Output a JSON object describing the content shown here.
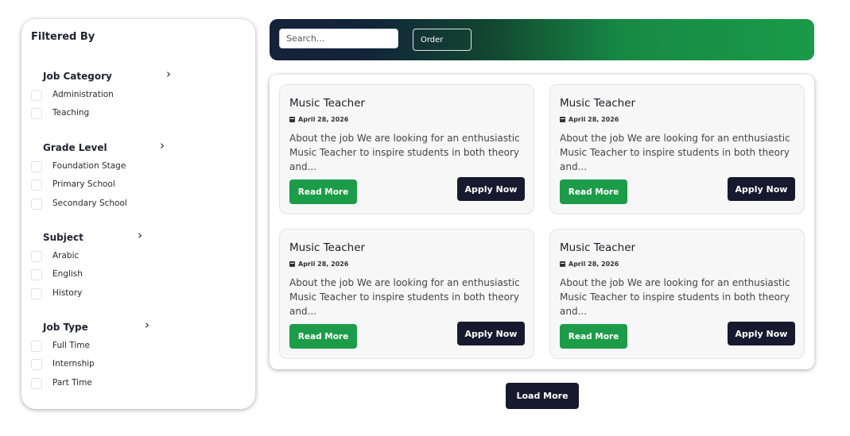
{
  "sidebar": {
    "title": "Filtered By",
    "groups": [
      {
        "heading": "Job Category",
        "options": [
          "Administration",
          "Teaching"
        ]
      },
      {
        "heading": "Grade Level",
        "options": [
          "Foundation Stage",
          "Primary School",
          "Secondary School"
        ]
      },
      {
        "heading": "Subject",
        "options": [
          "Arabic",
          "English",
          "History"
        ]
      },
      {
        "heading": "Job Type",
        "options": [
          "Full Time",
          "Internship",
          "Part Time"
        ]
      }
    ],
    "chevron": "›"
  },
  "toolbar": {
    "search_placeholder": "Search...",
    "order_label": "Order"
  },
  "jobs": [
    {
      "title": "Music Teacher",
      "date": "April 28, 2026",
      "description": "About the job We are looking for an enthusiastic Music Teacher to inspire students in both theory and...",
      "read_more": "Read More",
      "apply": "Apply Now"
    },
    {
      "title": "Music Teacher",
      "date": "April 28, 2026",
      "description": "About the job We are looking for an enthusiastic Music Teacher to inspire students in both theory and...",
      "read_more": "Read More",
      "apply": "Apply Now"
    },
    {
      "title": "Music Teacher",
      "date": "April 28, 2026",
      "description": "About the job We are looking for an enthusiastic Music Teacher to inspire students in both theory and...",
      "read_more": "Read More",
      "apply": "Apply Now"
    },
    {
      "title": "Music Teacher",
      "date": "April 28, 2026",
      "description": "About the job We are looking for an enthusiastic Music Teacher to inspire students in both theory and...",
      "read_more": "Read More",
      "apply": "Apply Now"
    }
  ],
  "load_more_label": "Load More",
  "colors": {
    "accent_green": "#1c9c48",
    "dark_navy": "#171a2e"
  }
}
